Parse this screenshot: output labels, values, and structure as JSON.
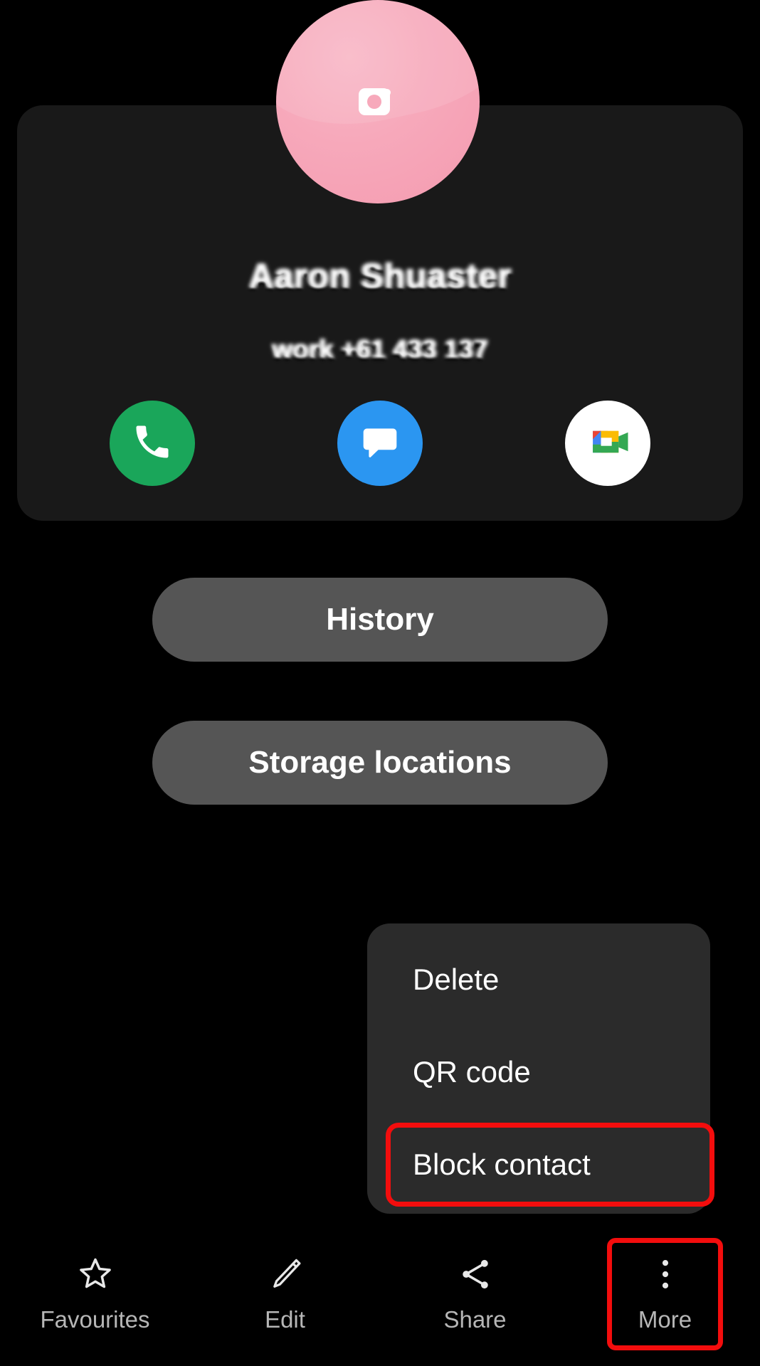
{
  "screen": {
    "background_color": "#000000",
    "app": "Contacts"
  },
  "contact": {
    "avatar": {
      "icon": "camera-icon",
      "background_color": "#f7a9bb",
      "redacted": false
    },
    "name": "Aaron Shuaster",
    "name_redacted": true,
    "phone_number": "work +61 433 137",
    "number_redacted": true,
    "card_background": "#191919",
    "actions": [
      {
        "name": "call",
        "icon": "phone-icon",
        "color": "#1aa65a"
      },
      {
        "name": "message",
        "icon": "message-icon",
        "color": "#2b96f1"
      },
      {
        "name": "video-call",
        "icon": "google-meet-icon",
        "color": "#ffffff"
      }
    ]
  },
  "buttons": [
    {
      "id": "history",
      "label": "History",
      "color": "#555555"
    },
    {
      "id": "storage-locations",
      "label": "Storage locations",
      "color": "#555555"
    }
  ],
  "popup_menu": {
    "background": "#2b2b2b",
    "highlight_color": "#f30d0d",
    "items": [
      {
        "id": "delete",
        "label": "Delete",
        "highlighted": false
      },
      {
        "id": "qr-code",
        "label": "QR code",
        "highlighted": false
      },
      {
        "id": "block-contact",
        "label": "Block contact",
        "highlighted": true
      }
    ]
  },
  "bottom_nav": {
    "highlight_color": "#f30d0d",
    "items": [
      {
        "id": "favourites",
        "label": "Favourites",
        "icon": "star-icon",
        "highlighted": false
      },
      {
        "id": "edit",
        "label": "Edit",
        "icon": "pencil-icon",
        "highlighted": false
      },
      {
        "id": "share",
        "label": "Share",
        "icon": "share-icon",
        "highlighted": false
      },
      {
        "id": "more",
        "label": "More",
        "icon": "more-vertical-icon",
        "highlighted": true
      }
    ]
  }
}
